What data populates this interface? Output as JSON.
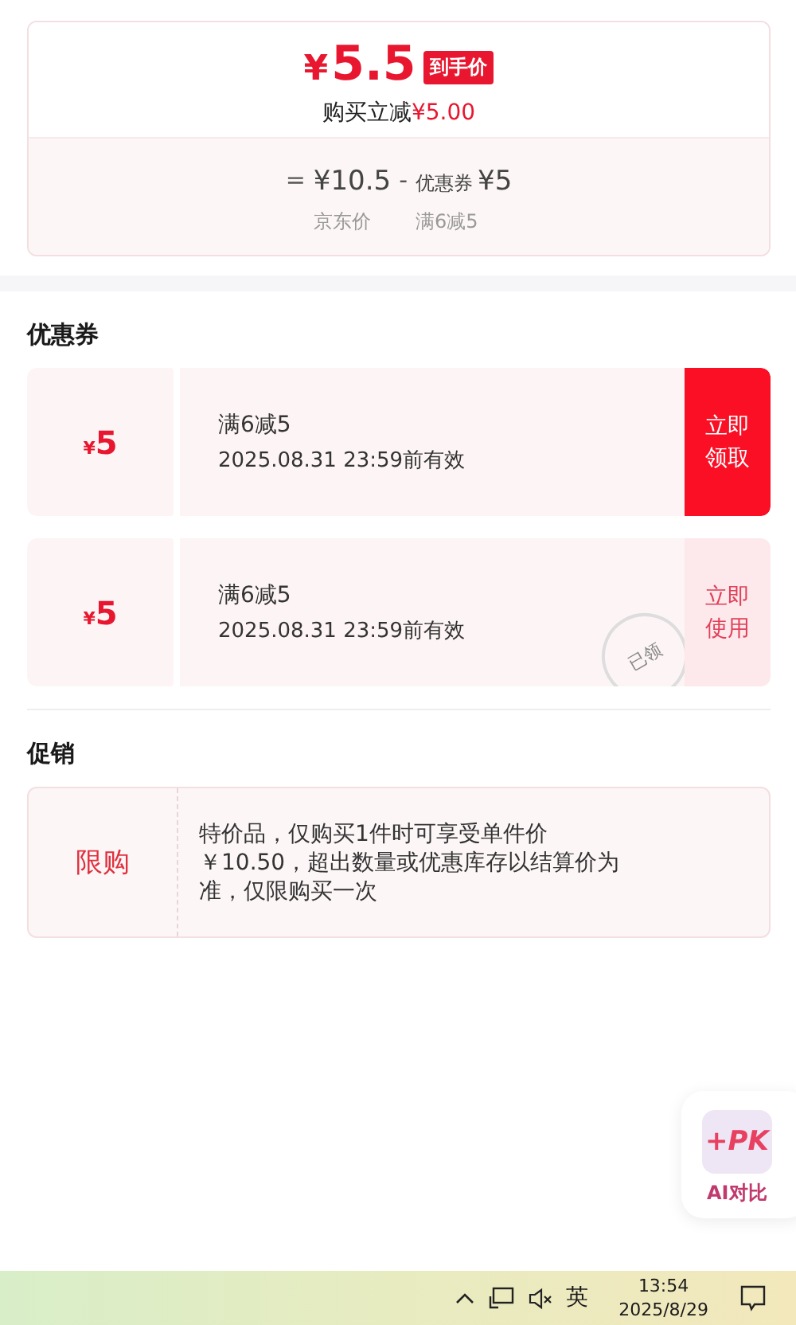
{
  "price_card": {
    "final_price_symbol": "¥",
    "final_price": "5.5",
    "final_tag": "到手价",
    "saving_label": "购买立减",
    "saving_amount": "¥5.00",
    "formula": [
      {
        "kind": "op",
        "text": "="
      },
      {
        "kind": "amount",
        "text": "¥10.5",
        "caption": "京东价"
      },
      {
        "kind": "op",
        "text": "-"
      },
      {
        "kind": "coupon",
        "prefix": "优惠券",
        "text": "¥5",
        "caption": "满6减5"
      }
    ]
  },
  "coupons_section": {
    "title": "优惠券",
    "coupons": [
      {
        "symbol": "¥",
        "amount": "5",
        "rule": "满6减5",
        "validity": "2025.08.31 23:59前有效",
        "action": "立即领取",
        "claimed": false
      },
      {
        "symbol": "¥",
        "amount": "5",
        "rule": "满6减5",
        "validity": "2025.08.31 23:59前有效",
        "action": "立即使用",
        "claimed": true,
        "stamp": "已领"
      }
    ]
  },
  "promotion_section": {
    "title": "促销",
    "items": [
      {
        "tag": "限购",
        "text": "特价品，仅购买1件时可享受单件价￥10.50，超出数量或优惠库存以结算价为准，仅限购买一次"
      }
    ]
  },
  "compare_widget": {
    "logo": "+PK",
    "label": "AI对比"
  },
  "taskbar": {
    "ime": "英",
    "time": "13:54",
    "date": "2025/8/29",
    "muted": true
  }
}
